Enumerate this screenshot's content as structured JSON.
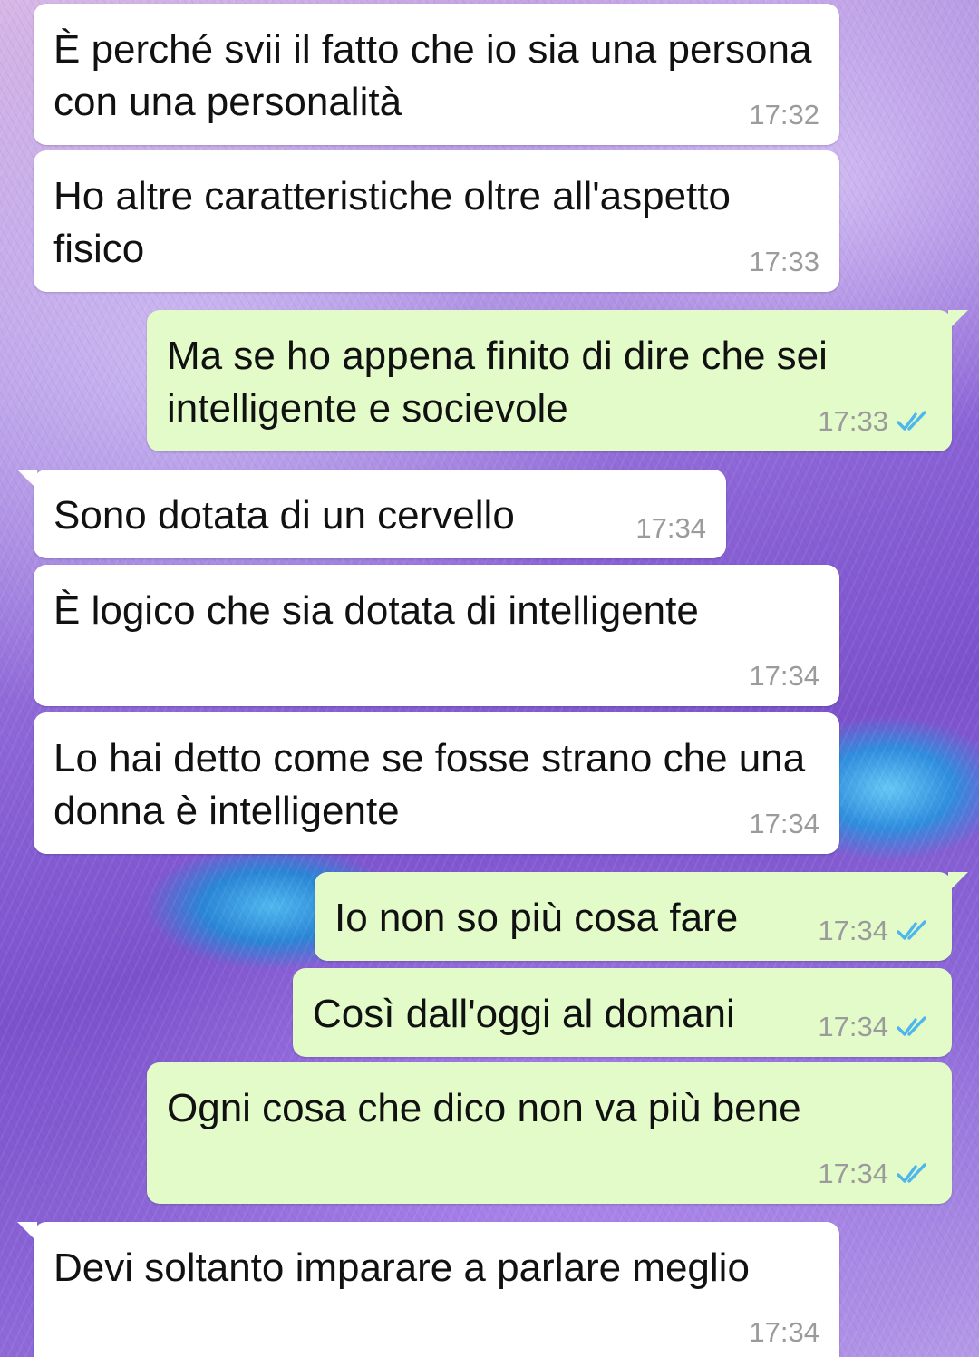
{
  "messages": [
    {
      "dir": "in",
      "text": "È perché svii il fatto che io sia una persona con una personalità",
      "time": "17:32",
      "tail": false
    },
    {
      "dir": "in",
      "text": "Ho altre caratteristiche oltre all'aspetto fisico",
      "time": "17:33",
      "tail": false
    },
    {
      "dir": "out",
      "text": "Ma se ho appena finito di dire che sei intelligente e socievole",
      "time": "17:33",
      "tail": true,
      "status": "read-check-icon"
    },
    {
      "dir": "in",
      "text": "Sono dotata di un cervello",
      "time": "17:34",
      "tail": true
    },
    {
      "dir": "in",
      "text": "È logico che sia dotata di intelligente",
      "time": "17:34",
      "tail": false
    },
    {
      "dir": "in",
      "text": "Lo hai detto come se fosse strano che una donna è intelligente",
      "time": "17:34",
      "tail": false
    },
    {
      "dir": "out",
      "text": "Io non so più cosa fare",
      "time": "17:34",
      "tail": true,
      "status": "read-check-icon"
    },
    {
      "dir": "out",
      "text": "Così dall'oggi al domani",
      "time": "17:34",
      "tail": false,
      "status": "read-check-icon"
    },
    {
      "dir": "out",
      "text": "Ogni cosa che dico non va più bene",
      "time": "17:34",
      "tail": false,
      "status": "read-check-icon"
    },
    {
      "dir": "in",
      "text": "Devi soltanto imparare a parlare meglio",
      "time": "17:34",
      "tail": true
    }
  ],
  "colors": {
    "incoming_bubble": "#ffffff",
    "outgoing_bubble": "#e2fbc9",
    "read_check": "#4fb6ec",
    "timestamp": "#9b9b9b"
  }
}
